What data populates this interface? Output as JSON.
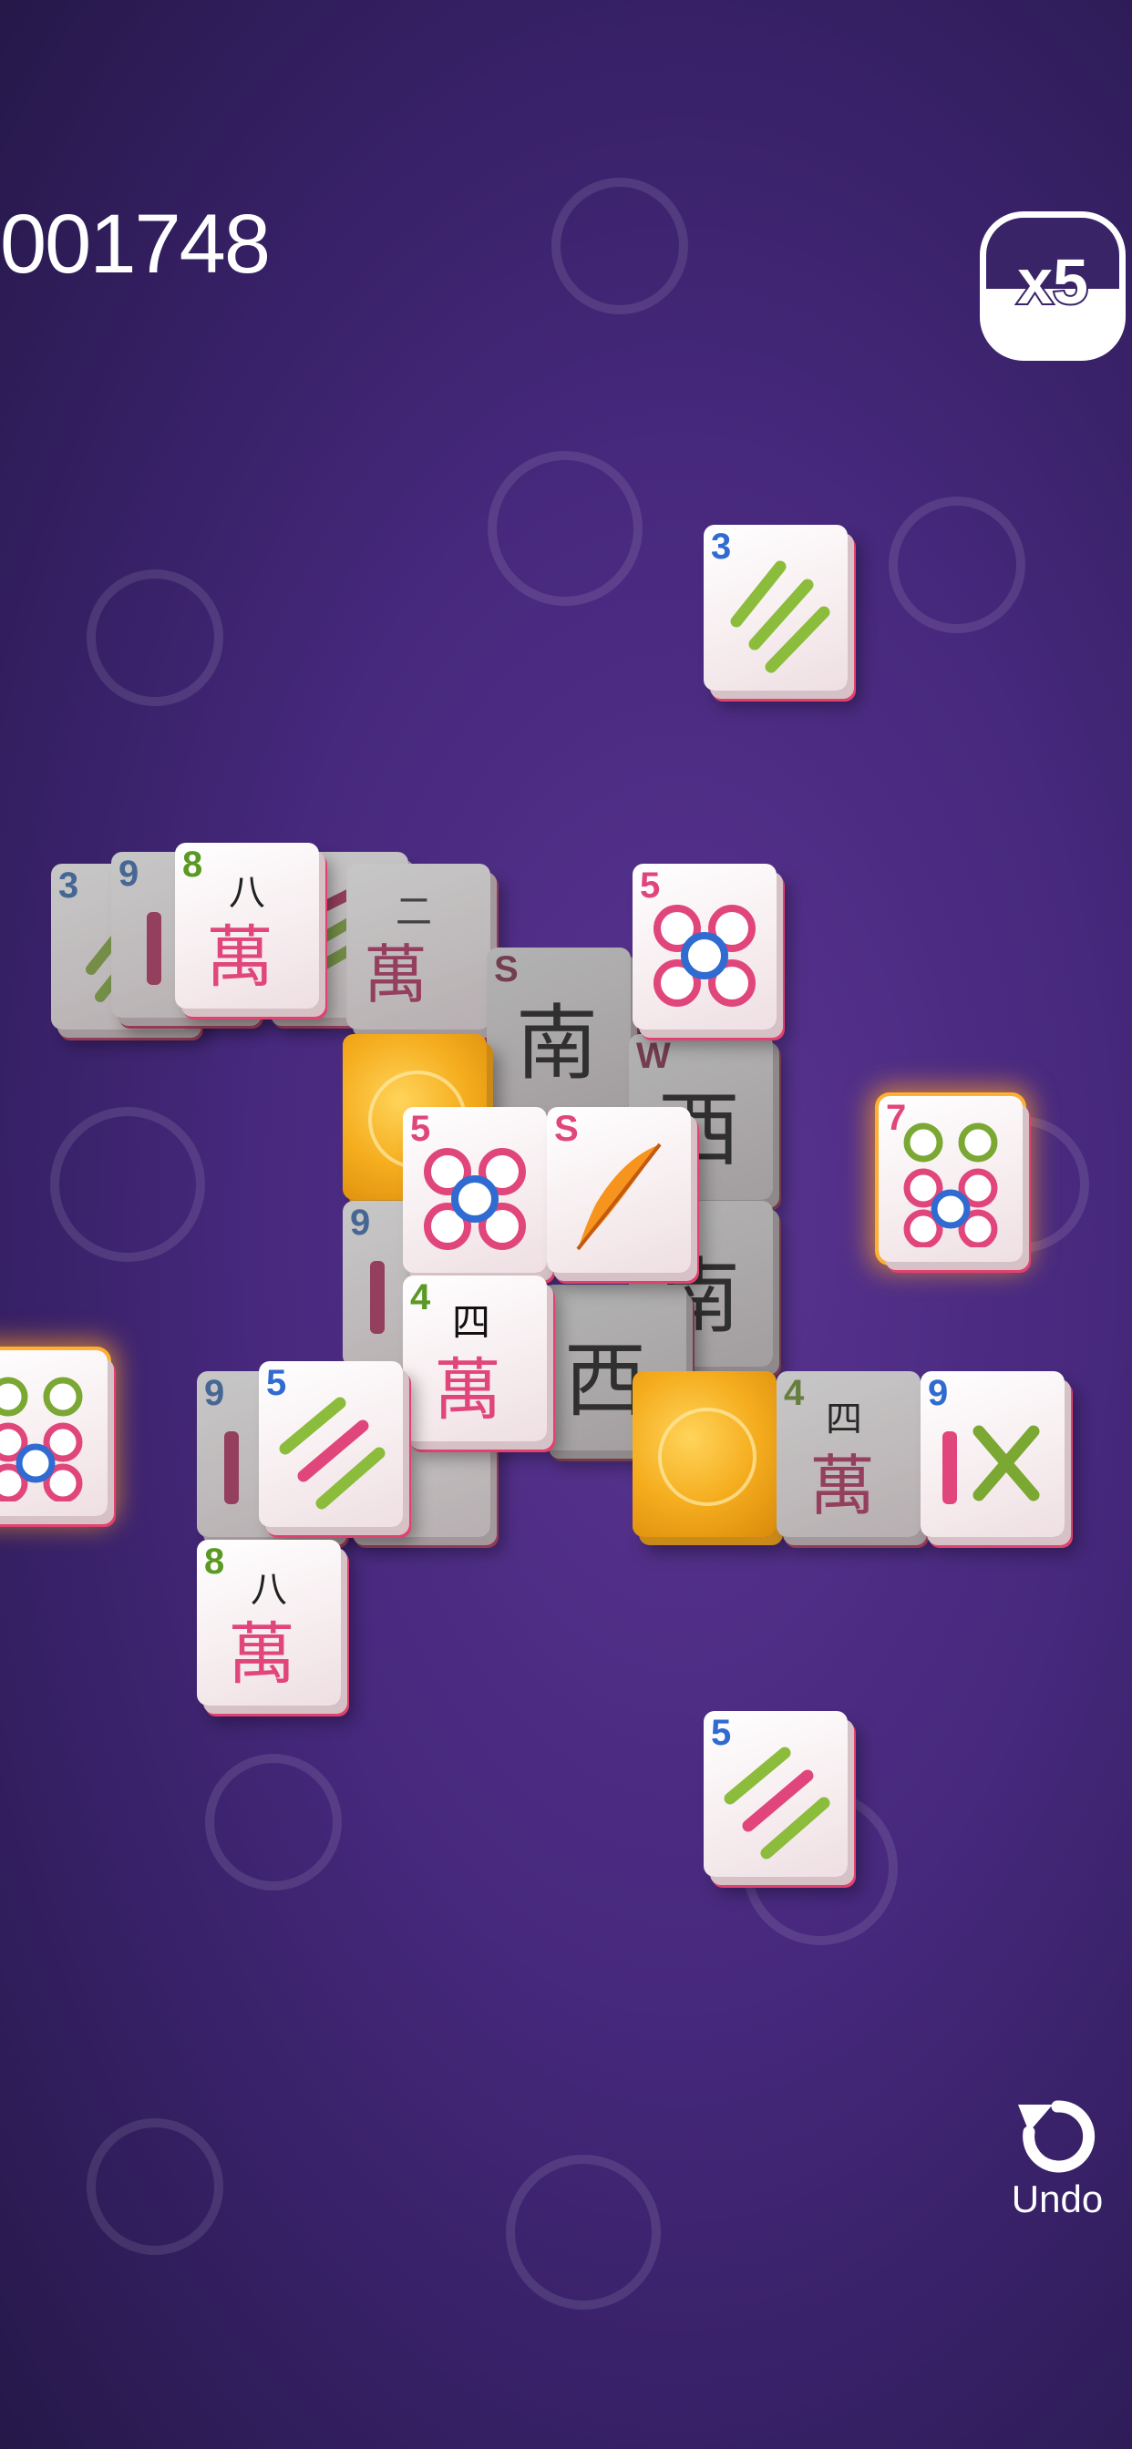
{
  "hud": {
    "score": "001748",
    "multiplier": "x5",
    "undo_label": "Undo"
  },
  "colors": {
    "background": "#46287c",
    "tile_face": "#f7eef0",
    "tile_edge": "#e2416f",
    "gold_tile": "#f5ad1e",
    "highlight": "#ffb02e"
  },
  "tiles": [
    {
      "id": "bamboo-3-top",
      "suit": "bamboo",
      "rank": "3"
    },
    {
      "id": "bamboo-3-back",
      "suit": "bamboo",
      "rank": "3"
    },
    {
      "id": "bamboo-9-back",
      "suit": "bamboo",
      "rank": "9"
    },
    {
      "id": "character-8-top",
      "suit": "character",
      "rank": "8",
      "glyph": "八",
      "glyph2": "萬"
    },
    {
      "id": "circle-5-top",
      "suit": "circle",
      "rank": "5"
    },
    {
      "id": "wind-south-back",
      "suit": "wind",
      "rank": "S",
      "glyph": "南"
    },
    {
      "id": "wind-west",
      "suit": "wind",
      "rank": "W",
      "glyph": "西"
    },
    {
      "id": "circle-7-highlight-right",
      "suit": "circle",
      "rank": "7"
    },
    {
      "id": "circle-5-center",
      "suit": "circle",
      "rank": "5"
    },
    {
      "id": "season-feather",
      "suit": "season",
      "rank": "S"
    },
    {
      "id": "character-4-center",
      "suit": "character",
      "rank": "4",
      "glyph": "四",
      "glyph2": "萬"
    },
    {
      "id": "bamboo-9-mid",
      "suit": "bamboo",
      "rank": "9"
    },
    {
      "id": "bamboo-5-left",
      "suit": "bamboo",
      "rank": "5"
    },
    {
      "id": "character-4-right",
      "suit": "character",
      "rank": "4",
      "glyph": "四",
      "glyph2": "萬"
    },
    {
      "id": "bamboo-9-right",
      "suit": "bamboo",
      "rank": "9"
    },
    {
      "id": "circle-7-highlight-left",
      "suit": "circle",
      "rank": "7"
    },
    {
      "id": "character-8-bottom",
      "suit": "character",
      "rank": "8",
      "glyph": "八",
      "glyph2": "萬"
    },
    {
      "id": "bamboo-5-bottom",
      "suit": "bamboo",
      "rank": "5"
    },
    {
      "id": "gold-tile-1",
      "suit": "gold"
    },
    {
      "id": "gold-tile-2",
      "suit": "gold"
    }
  ]
}
